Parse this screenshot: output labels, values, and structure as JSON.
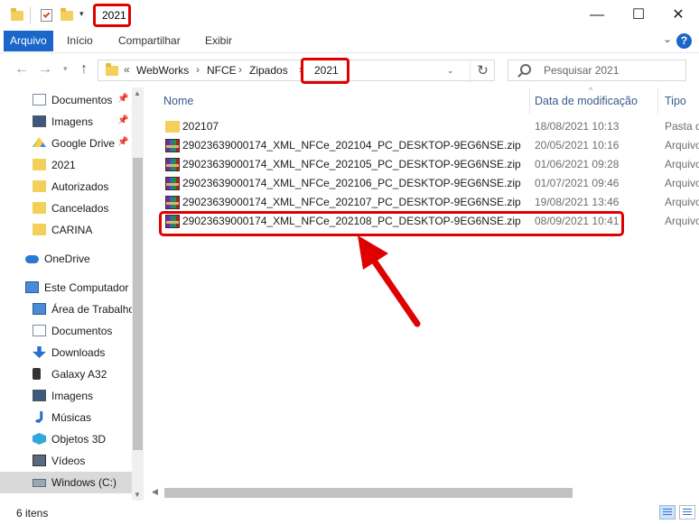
{
  "window": {
    "title": "2021",
    "minimize": "—",
    "maximize": "☐",
    "close": "✕"
  },
  "ribbon": {
    "tabs": [
      "Arquivo",
      "Início",
      "Compartilhar",
      "Exibir"
    ],
    "help": "?"
  },
  "address": {
    "crumbs": [
      "WebWorks",
      "NFCE",
      "Zipados",
      "2021"
    ],
    "overflow": "«",
    "separator": "›",
    "search_placeholder": "Pesquisar 2021"
  },
  "nav": {
    "items": [
      {
        "label": "Documentos",
        "icon": "documents-icon",
        "pinned": true
      },
      {
        "label": "Imagens",
        "icon": "pictures-icon",
        "pinned": true
      },
      {
        "label": "Google Drive",
        "icon": "google-drive-icon",
        "pinned": true
      },
      {
        "label": "2021",
        "icon": "folder-icon",
        "pinned": false
      },
      {
        "label": "Autorizados",
        "icon": "folder-icon",
        "pinned": false
      },
      {
        "label": "Cancelados",
        "icon": "folder-icon",
        "pinned": false
      },
      {
        "label": "CARINA",
        "icon": "folder-icon",
        "pinned": false
      },
      {
        "label": "OneDrive",
        "icon": "onedrive-icon",
        "pinned": false
      },
      {
        "label": "Este Computador",
        "icon": "computer-icon",
        "pinned": false
      },
      {
        "label": "Área de Trabalho",
        "icon": "desktop-icon",
        "pinned": false
      },
      {
        "label": "Documentos",
        "icon": "documents-icon",
        "pinned": false
      },
      {
        "label": "Downloads",
        "icon": "downloads-icon",
        "pinned": false
      },
      {
        "label": "Galaxy A32",
        "icon": "phone-icon",
        "pinned": false
      },
      {
        "label": "Imagens",
        "icon": "pictures-icon",
        "pinned": false
      },
      {
        "label": "Músicas",
        "icon": "music-icon",
        "pinned": false
      },
      {
        "label": "Objetos 3D",
        "icon": "objects-3d-icon",
        "pinned": false
      },
      {
        "label": "Vídeos",
        "icon": "videos-icon",
        "pinned": false
      },
      {
        "label": "Windows (C:)",
        "icon": "drive-icon",
        "pinned": false
      }
    ]
  },
  "columns": {
    "name": "Nome",
    "date": "Data de modificação",
    "type": "Tipo"
  },
  "files": [
    {
      "name": "202107",
      "date": "18/08/2021 10:13",
      "type": "Pasta d",
      "kind": "folder"
    },
    {
      "name": "29023639000174_XML_NFCe_202104_PC_DESKTOP-9EG6NSE.zip",
      "date": "20/05/2021 10:16",
      "type": "Arquivo",
      "kind": "archive"
    },
    {
      "name": "29023639000174_XML_NFCe_202105_PC_DESKTOP-9EG6NSE.zip",
      "date": "01/06/2021 09:28",
      "type": "Arquivo",
      "kind": "archive"
    },
    {
      "name": "29023639000174_XML_NFCe_202106_PC_DESKTOP-9EG6NSE.zip",
      "date": "01/07/2021 09:46",
      "type": "Arquivo",
      "kind": "archive"
    },
    {
      "name": "29023639000174_XML_NFCe_202107_PC_DESKTOP-9EG6NSE.zip",
      "date": "19/08/2021 13:46",
      "type": "Arquivo",
      "kind": "archive"
    },
    {
      "name": "29023639000174_XML_NFCe_202108_PC_DESKTOP-9EG6NSE.zip",
      "date": "08/09/2021 10:41",
      "type": "Arquivo",
      "kind": "archive"
    }
  ],
  "status": {
    "count": "6 itens"
  },
  "colors": {
    "accent": "#1a66c9",
    "highlight": "#e00000",
    "folder": "#f3cf5b"
  }
}
